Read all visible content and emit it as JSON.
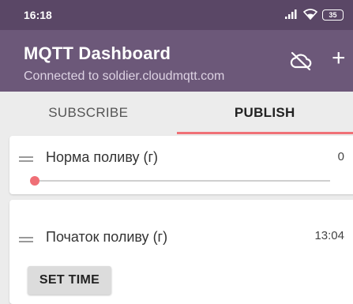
{
  "status_bar": {
    "time": "16:18",
    "battery": "35",
    "icons": [
      "signal-icon",
      "wifi-icon",
      "battery-icon"
    ]
  },
  "app_bar": {
    "title": "MQTT Dashboard",
    "subtitle": "Connected to soldier.cloudmqtt.com",
    "actions": [
      "cloud-off-icon",
      "add-icon"
    ],
    "add_glyph": "+"
  },
  "tabs": [
    {
      "label": "SUBSCRIBE",
      "active": false
    },
    {
      "label": "PUBLISH",
      "active": true
    }
  ],
  "cards": [
    {
      "title": "Норма поливу (г)",
      "value": "0",
      "control": "slider",
      "slider_value": 0
    },
    {
      "title": "Початок поливу (г)",
      "value": "13:04",
      "control": "button",
      "button_label": "SET TIME"
    }
  ],
  "colors": {
    "status_bar": "#5a4766",
    "app_bar": "#6c5879",
    "accent": "#f07177"
  }
}
